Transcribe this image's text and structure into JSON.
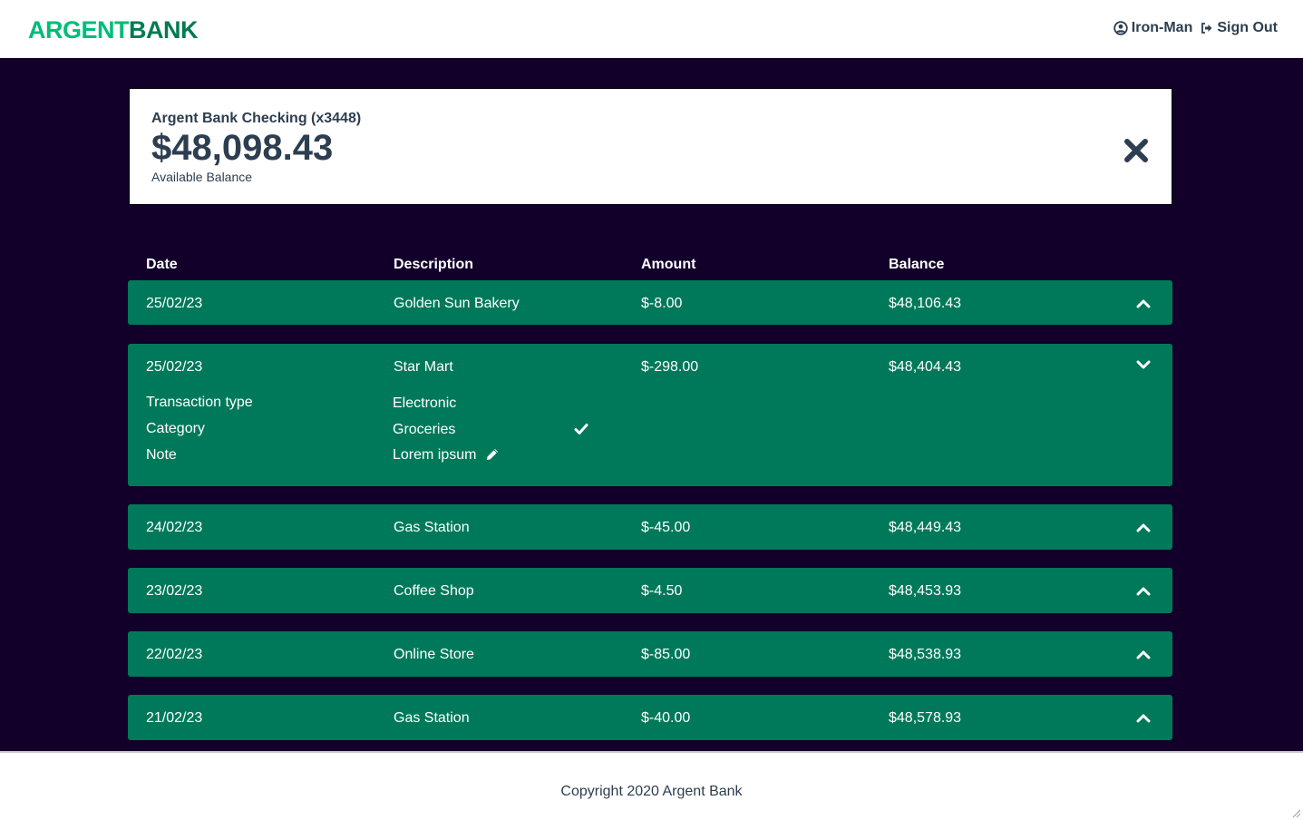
{
  "header": {
    "logo_part1": "ARGENT",
    "logo_part2": "BANK",
    "user_name": "Iron-Man",
    "signout_label": "Sign Out",
    "icons": [
      "user-circle-icon",
      "sign-out-icon"
    ]
  },
  "account": {
    "title": "Argent Bank Checking (x3448)",
    "amount": "$48,098.43",
    "description": "Available Balance",
    "close_icon": "close-icon"
  },
  "table": {
    "headers": [
      "Date",
      "Description",
      "Amount",
      "Balance"
    ],
    "rows": [
      {
        "date": "25/02/23",
        "description": "Golden Sun Bakery",
        "amount": "$-8.00",
        "balance": "$48,106.43",
        "expanded": false
      },
      {
        "date": "25/02/23",
        "description": "Star Mart",
        "amount": "$-298.00",
        "balance": "$48,404.43",
        "expanded": true
      },
      {
        "date": "24/02/23",
        "description": "Gas Station",
        "amount": "$-45.00",
        "balance": "$48,449.43",
        "expanded": false
      },
      {
        "date": "23/02/23",
        "description": "Coffee Shop",
        "amount": "$-4.50",
        "balance": "$48,453.93",
        "expanded": false
      },
      {
        "date": "22/02/23",
        "description": "Online Store",
        "amount": "$-85.00",
        "balance": "$48,538.93",
        "expanded": false
      },
      {
        "date": "21/02/23",
        "description": "Gas Station",
        "amount": "$-40.00",
        "balance": "$48,578.93",
        "expanded": false
      }
    ],
    "details": {
      "type_label": "Transaction type",
      "type_value": "Electronic",
      "category_label": "Category",
      "category_value": "Groceries",
      "note_label": "Note",
      "note_value": "Lorem ipsum"
    }
  },
  "footer": {
    "copyright": "Copyright 2020 Argent Bank"
  },
  "colors": {
    "brand_light": "#00bc77",
    "brand_dark": "#037a52",
    "main_bg": "#12002b",
    "row_bg": "#00795a",
    "text_dark": "#2c3e50"
  }
}
